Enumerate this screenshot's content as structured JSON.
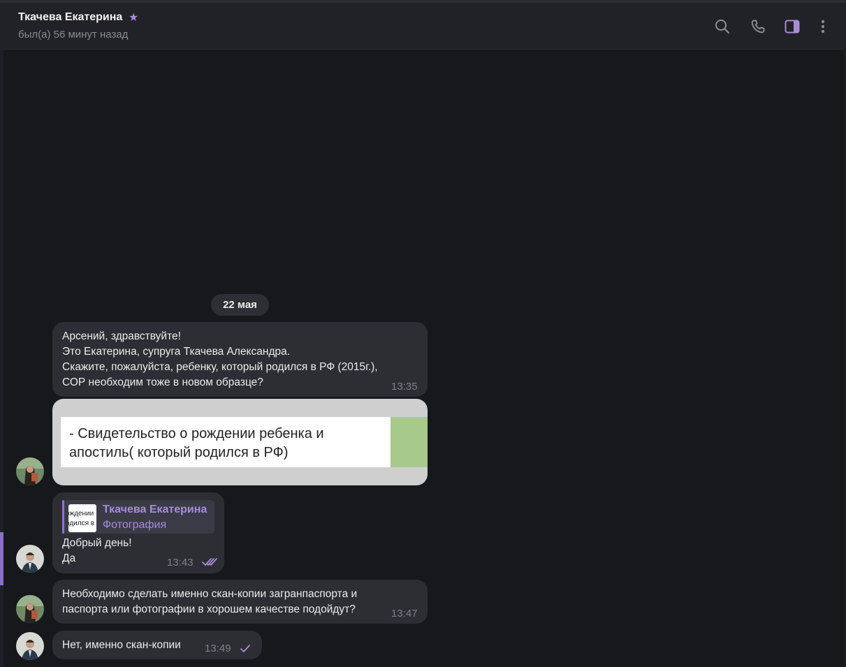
{
  "header": {
    "name": "Ткачева Екатерина",
    "status": "был(а) 56 минут назад",
    "icons": [
      "star-icon",
      "search-icon",
      "phone-icon",
      "sidebar-toggle-icon",
      "more-icon"
    ]
  },
  "date_separator": "22 мая",
  "messages": [
    {
      "lines": [
        "Арсений, здравствуйте!",
        "Это Екатерина, супруга Ткачева Александра.",
        "Скажите, пожалуйста, ребенку, который родился в РФ (2015г.),",
        "СОР необходим тоже в новом образце?"
      ],
      "time": "13:35"
    },
    {
      "photo_lines": [
        "- Свидетельство о рождении ребенка и",
        "апостиль( который родился в РФ)"
      ]
    },
    {
      "reply_name": "Ткачева Екатерина",
      "reply_type": "Фотография",
      "reply_thumb_lines": [
        "ождении",
        "одился в"
      ],
      "lines": [
        "Добрый день!",
        "Да"
      ],
      "time": "13:43",
      "status": "read"
    },
    {
      "lines": [
        "Необходимо сделать именно скан-копии загранпаспорта и",
        "паспорта или фотографии в хорошем качестве подойдут?"
      ],
      "time": "13:47"
    },
    {
      "lines": [
        "Нет, именно скан-копии"
      ],
      "time": "13:49",
      "status": "sent"
    }
  ],
  "colors": {
    "background": "#17181c",
    "bubble": "#2c2e34",
    "accent": "#a98bd8"
  }
}
